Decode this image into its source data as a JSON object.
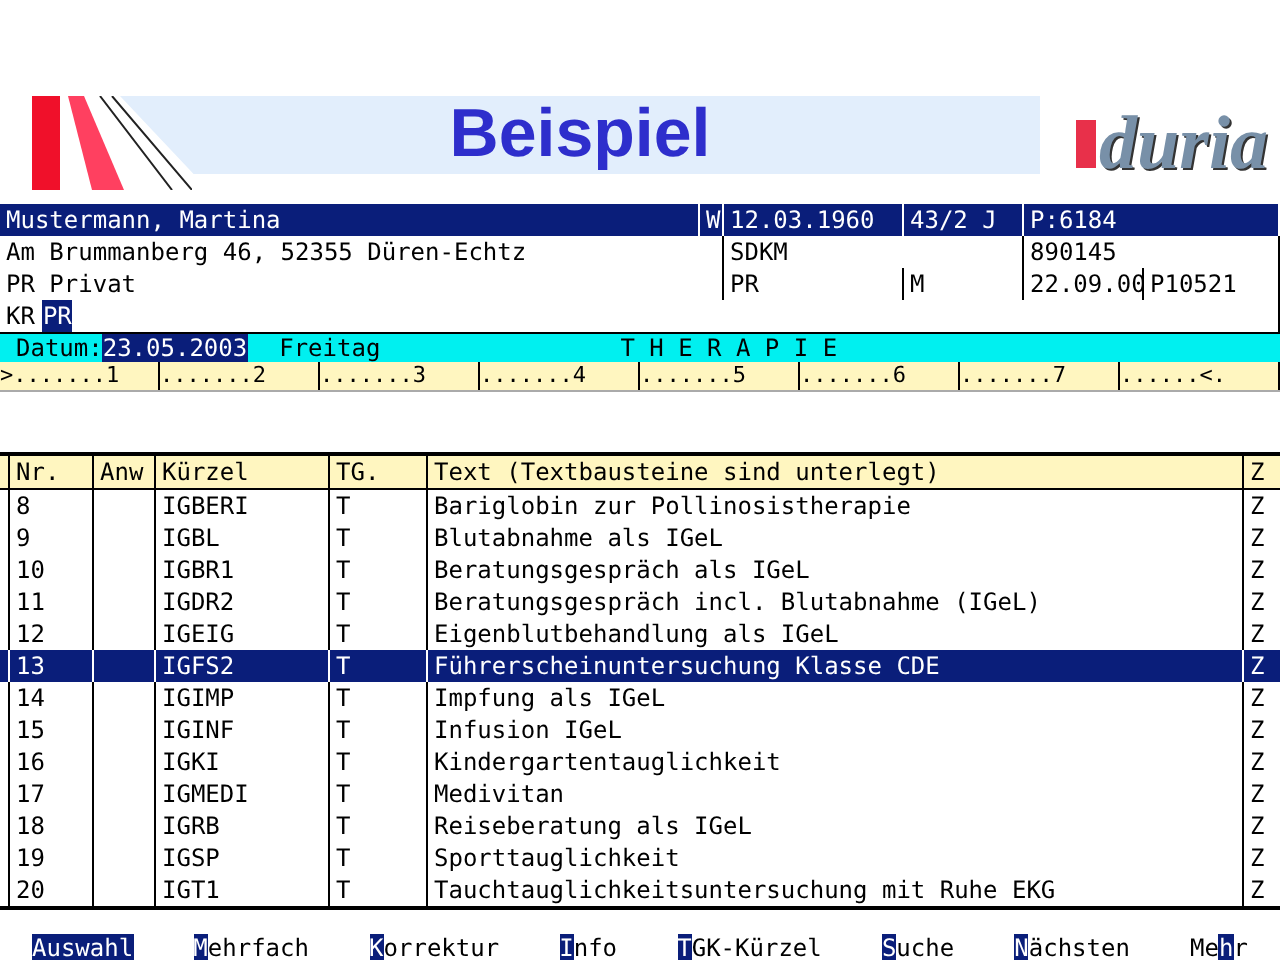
{
  "banner": {
    "title": "Beispiel",
    "logo": "duria"
  },
  "patient": {
    "name": "Mustermann, Martina",
    "sex": "W",
    "birth_date": "12.03.1960",
    "age": "43/2 J",
    "patient_no": "P:6184",
    "address": "Am Brummanberg 46, 52355 Düren-Echtz",
    "code_1": "SDKM",
    "code_2": "890145",
    "insurance": "PR Privat",
    "ins_code": "PR",
    "ins_flag": "M",
    "ins_date": "22.09.00",
    "ins_no": "P10521",
    "kr_label": "KR",
    "kr_value": "PR"
  },
  "status": {
    "date_label": "Datum:",
    "date": "23.05.2003",
    "weekday": "Freitag",
    "mode": "T H E R A P I E"
  },
  "ruler": [
    ">.......1",
    ".......2",
    ".......3",
    ".......4",
    ".......5",
    ".......6",
    ".......7",
    "......<."
  ],
  "table": {
    "columns": [
      "Nr.",
      "Anw",
      "Kürzel",
      "TG.",
      "Text (Textbausteine sind unterlegt)",
      "Z"
    ],
    "rows": [
      {
        "cells": [
          "8",
          "",
          "IGBERI",
          "T",
          "Bariglobin zur Pollinosistherapie",
          "Z"
        ],
        "selected": false
      },
      {
        "cells": [
          "9",
          "",
          "IGBL",
          "T",
          "Blutabnahme als IGeL",
          "Z"
        ],
        "selected": false
      },
      {
        "cells": [
          "10",
          "",
          "IGBR1",
          "T",
          "Beratungsgespräch als IGeL",
          "Z"
        ],
        "selected": false
      },
      {
        "cells": [
          "11",
          "",
          "IGDR2",
          "T",
          "Beratungsgespräch incl. Blutabnahme (IGeL)",
          "Z"
        ],
        "selected": false
      },
      {
        "cells": [
          "12",
          "",
          "IGEIG",
          "T",
          "Eigenblutbehandlung als IGeL",
          "Z"
        ],
        "selected": false
      },
      {
        "cells": [
          "13",
          "",
          "IGFS2",
          "T",
          "Führerscheinuntersuchung Klasse CDE",
          "Z"
        ],
        "selected": true
      },
      {
        "cells": [
          "14",
          "",
          "IGIMP",
          "T",
          "Impfung als IGeL",
          "Z"
        ],
        "selected": false
      },
      {
        "cells": [
          "15",
          "",
          "IGINF",
          "T",
          "Infusion IGeL",
          "Z"
        ],
        "selected": false
      },
      {
        "cells": [
          "16",
          "",
          "IGKI",
          "T",
          "Kindergartentauglichkeit",
          "Z"
        ],
        "selected": false
      },
      {
        "cells": [
          "17",
          "",
          "IGMEDI",
          "T",
          "Medivitan",
          "Z"
        ],
        "selected": false
      },
      {
        "cells": [
          "18",
          "",
          "IGRB",
          "T",
          "Reiseberatung als IGeL",
          "Z"
        ],
        "selected": false
      },
      {
        "cells": [
          "19",
          "",
          "IGSP",
          "T",
          "Sporttauglichkeit",
          "Z"
        ],
        "selected": false
      },
      {
        "cells": [
          "20",
          "",
          "IGT1",
          "T",
          "Tauchtauglichkeitsuntersuchung mit Ruhe EKG",
          "Z"
        ],
        "selected": false
      }
    ]
  },
  "function_keys": [
    {
      "key": "A",
      "after": "uswahl",
      "selected": true
    },
    {
      "key": "M",
      "after": "ehrfach",
      "selected": false
    },
    {
      "key": "K",
      "after": "orrektur",
      "selected": false
    },
    {
      "key": "I",
      "after": "nfo",
      "selected": false
    },
    {
      "key": "T",
      "after": "GK-Kürzel",
      "selected": false
    },
    {
      "key": "S",
      "after": "uche",
      "selected": false
    },
    {
      "key": "N",
      "after": "ächsten",
      "selected": false
    },
    {
      "before": "Me",
      "key": "h",
      "after": "r",
      "selected": false
    }
  ]
}
